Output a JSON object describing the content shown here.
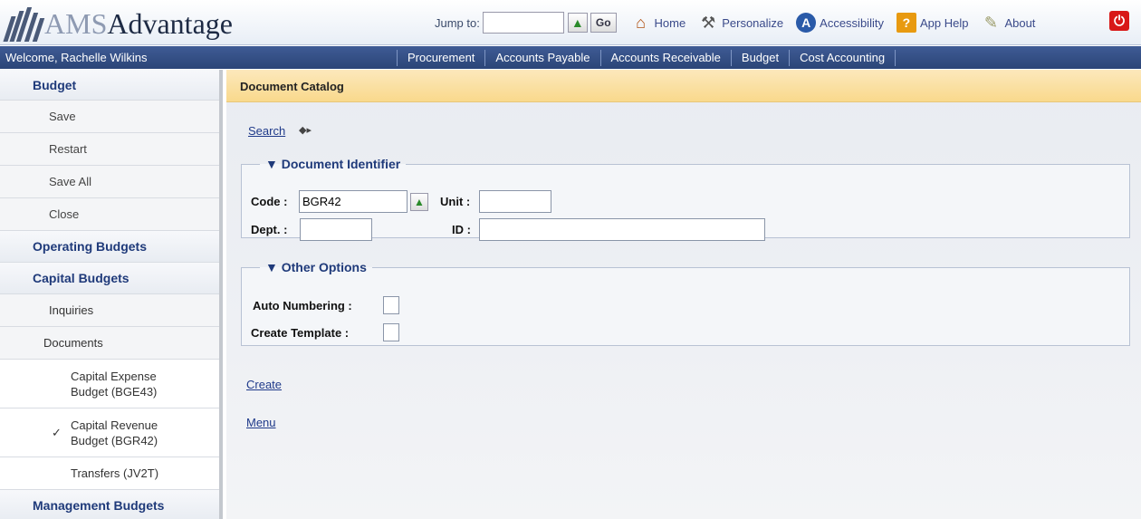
{
  "app": {
    "logo_prefix": "AMS",
    "logo_suffix": "Advantage"
  },
  "topbar": {
    "jump_label": "Jump to:",
    "jump_value": "",
    "go_label": "Go",
    "links": [
      {
        "label": "Home",
        "icon": "home-icon"
      },
      {
        "label": "Personalize",
        "icon": "wrench-icon"
      },
      {
        "label": "Accessibility",
        "icon": "accessibility-icon"
      },
      {
        "label": "App Help",
        "icon": "help-icon"
      },
      {
        "label": "About",
        "icon": "about-icon"
      }
    ]
  },
  "navbar": {
    "welcome": "Welcome, Rachelle Wilkins",
    "modules": [
      "Procurement",
      "Accounts Payable",
      "Accounts Receivable",
      "Budget",
      "Cost Accounting"
    ]
  },
  "sidebar": {
    "budget": "Budget",
    "actions": [
      "Save",
      "Restart",
      "Save All",
      "Close"
    ],
    "operating": "Operating Budgets",
    "capital": "Capital Budgets",
    "inquiries": "Inquiries",
    "documents": "Documents",
    "doc_items": [
      {
        "line1": "Capital Expense",
        "line2": "Budget (BGE43)"
      },
      {
        "line1": "Capital Revenue",
        "line2": "Budget (BGR42)"
      },
      {
        "line1": "Transfers (JV2T)",
        "line2": ""
      }
    ],
    "checkmark": "✓",
    "management": "Management Budgets"
  },
  "main": {
    "catalog_title": "Document Catalog",
    "search_label": "Search",
    "doc_identifier": {
      "legend": "Document Identifier",
      "code_label": "Code :",
      "code_value": "BGR42",
      "unit_label": "Unit :",
      "unit_value": "",
      "dept_label": "Dept. :",
      "dept_value": "",
      "id_label": "ID :",
      "id_value": ""
    },
    "other_options": {
      "legend": "Other Options",
      "auto_numbering_label": "Auto Numbering :",
      "create_template_label": "Create Template :"
    },
    "create_link": "Create",
    "menu_link": "Menu"
  },
  "colors": {
    "navbar": "#2b4577",
    "catalog_bar": "#f9d98c",
    "link": "#1f3a8a",
    "sidebar_heading": "#1f3a7a",
    "power": "#d81818"
  }
}
